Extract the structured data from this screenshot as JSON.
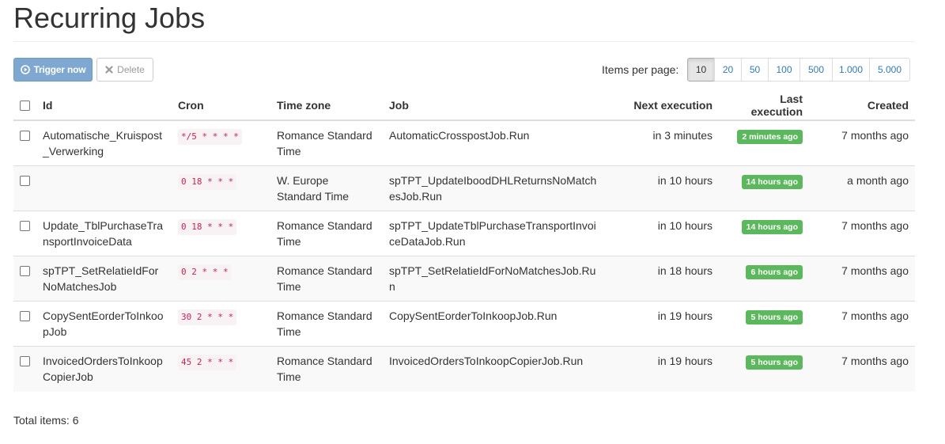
{
  "page": {
    "title": "Recurring Jobs"
  },
  "toolbar": {
    "trigger_label": "Trigger now",
    "delete_label": "Delete",
    "items_per_page_label": "Items per page:",
    "page_sizes": [
      "10",
      "20",
      "50",
      "100",
      "500",
      "1.000",
      "5.000"
    ],
    "selected_page_size": "10"
  },
  "table": {
    "headers": {
      "id": "Id",
      "cron": "Cron",
      "timezone": "Time zone",
      "job": "Job",
      "next": "Next execution",
      "last": "Last execution",
      "created": "Created"
    },
    "rows": [
      {
        "id": "Automatische_Kruispost_Verwerking",
        "cron": "*/5 * * * *",
        "timezone": "Romance Standard Time",
        "job": "AutomaticCrosspostJob.Run",
        "next": "in 3 minutes",
        "last": "2 minutes ago",
        "created": "7 months ago"
      },
      {
        "id": "",
        "cron": "0 18 * * *",
        "timezone": "W. Europe Standard Time",
        "job": "spTPT_UpdateIboodDHLReturnsNoMatchesJob.Run",
        "next": "in 10 hours",
        "last": "14 hours ago",
        "created": "a month ago"
      },
      {
        "id": "Update_TblPurchaseTransportInvoiceData",
        "cron": "0 18 * * *",
        "timezone": "Romance Standard Time",
        "job": "spTPT_UpdateTblPurchaseTransportInvoiceDataJob.Run",
        "next": "in 10 hours",
        "last": "14 hours ago",
        "created": "7 months ago"
      },
      {
        "id": "spTPT_SetRelatieIdForNoMatchesJob",
        "cron": "0 2 * * *",
        "timezone": "Romance Standard Time",
        "job": "spTPT_SetRelatieIdForNoMatchesJob.Run",
        "next": "in 18 hours",
        "last": "6 hours ago",
        "created": "7 months ago"
      },
      {
        "id": "CopySentEorderToInkoopJob",
        "cron": "30 2 * * *",
        "timezone": "Romance Standard Time",
        "job": "CopySentEorderToInkoopJob.Run",
        "next": "in 19 hours",
        "last": "5 hours ago",
        "created": "7 months ago"
      },
      {
        "id": "InvoicedOrdersToInkoopCopierJob",
        "cron": "45 2 * * *",
        "timezone": "Romance Standard Time",
        "job": "InvoicedOrdersToInkoopCopierJob.Run",
        "next": "in 19 hours",
        "last": "5 hours ago",
        "created": "7 months ago"
      }
    ]
  },
  "footer": {
    "total_items": "Total items: 6"
  },
  "colors": {
    "primary": "#7fa8d1",
    "success_badge": "#5cb85c",
    "cron_text": "#c7254e",
    "link": "#337ab7"
  },
  "icons": {
    "trigger": "play-circle-icon",
    "delete": "close-icon"
  }
}
